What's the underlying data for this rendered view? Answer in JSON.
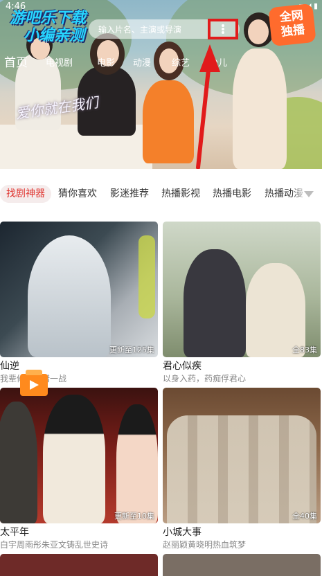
{
  "status_bar": {
    "time": "4:46",
    "icons": "▾ ◢ ▮"
  },
  "watermark": {
    "line1": "游吧乐下载",
    "line2": "小编亲测"
  },
  "search": {
    "placeholder": "输入片名、主演或导演"
  },
  "badge": {
    "line1": "全网",
    "line2": "独播"
  },
  "hero": {
    "caption": "爱你就在我们",
    "arrow_color": "#e11b1b"
  },
  "nav": {
    "items": [
      "首页",
      "电视剧",
      "电影",
      "动漫",
      "综艺",
      "少儿"
    ]
  },
  "tabs": {
    "items": [
      "找剧神器",
      "猜你喜欢",
      "影迷推荐",
      "热播影视",
      "热播电影",
      "热播动漫"
    ],
    "active_color": "#e0342f"
  },
  "cards": [
    {
      "title": "仙逆",
      "subtitle": "我辈修仙何惜一战",
      "episodes": "更新至125集"
    },
    {
      "title": "君心似疾",
      "subtitle": "以身入药，药痴俘君心",
      "episodes": "全83集"
    },
    {
      "title": "太平年",
      "subtitle": "白宇周雨彤朱亚文铸乱世史诗",
      "episodes": "更新至10集"
    },
    {
      "title": "小城大事",
      "subtitle": "赵丽颖黄晓明热血筑梦",
      "episodes": "全40集"
    }
  ]
}
